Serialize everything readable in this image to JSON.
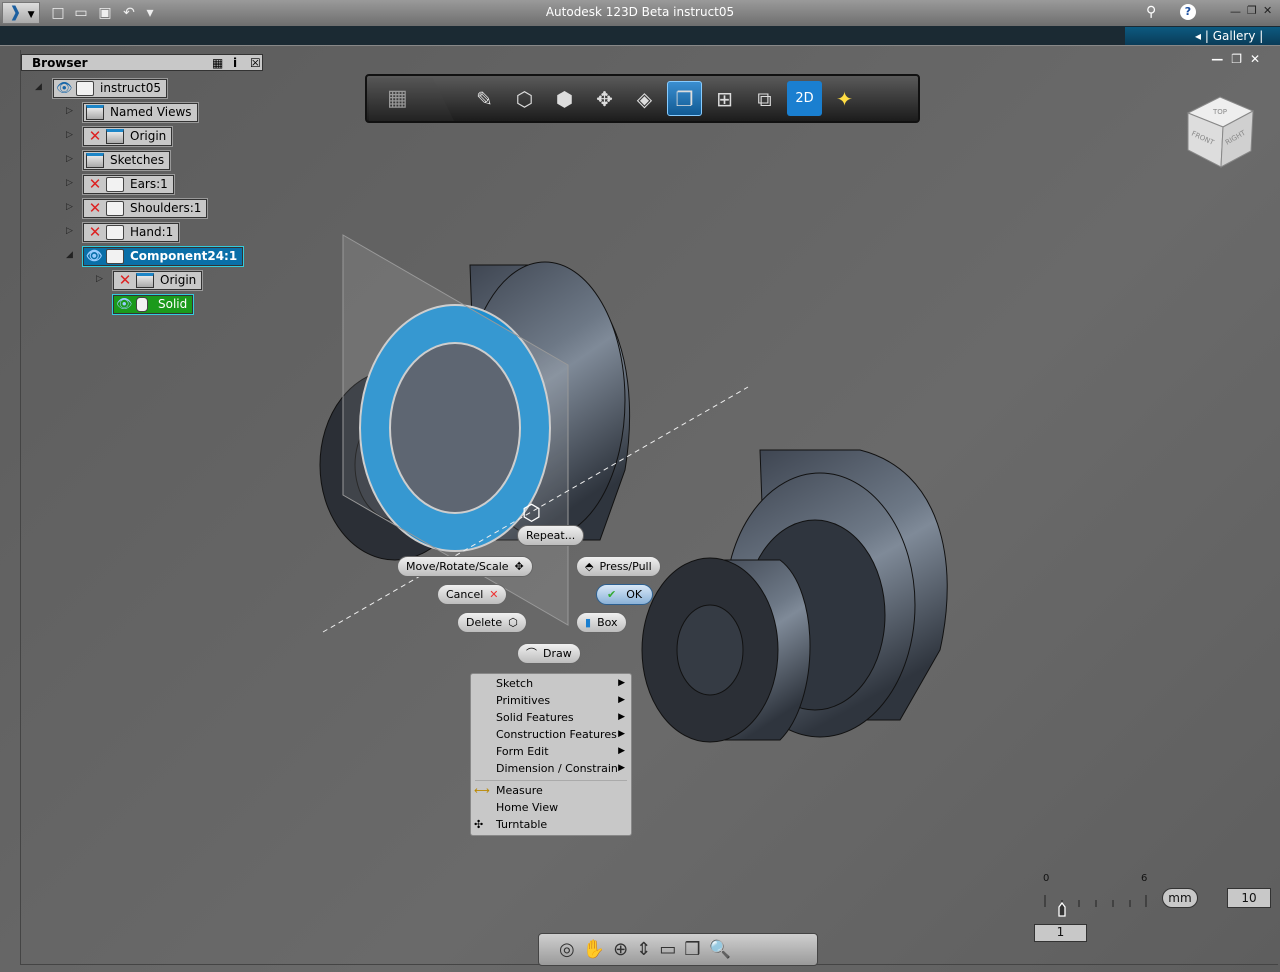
{
  "window": {
    "title": "Autodesk 123D Beta   instruct05",
    "gallery_label": "Gallery",
    "min": "—",
    "restore": "❐",
    "close": "✕"
  },
  "quick_access": [
    {
      "icon": "new-icon",
      "glyph": "□"
    },
    {
      "icon": "open-icon",
      "glyph": "▭"
    },
    {
      "icon": "save-icon",
      "glyph": "▣"
    },
    {
      "icon": "undo-icon",
      "glyph": "↶"
    },
    {
      "icon": "more-icon",
      "glyph": "▾"
    }
  ],
  "browser": {
    "title": "Browser",
    "nodes": [
      {
        "label": "instruct05",
        "visible": true
      },
      {
        "label": "Named Views"
      },
      {
        "label": "Origin",
        "visible": false
      },
      {
        "label": "Sketches"
      },
      {
        "label": "Ears:1",
        "visible": false
      },
      {
        "label": "Shoulders:1",
        "visible": false
      },
      {
        "label": "Hand:1",
        "visible": false
      },
      {
        "label": "Component24:1",
        "visible": true,
        "selected": true
      },
      {
        "label": "Origin",
        "visible": false
      },
      {
        "label": "Solid",
        "visible": true,
        "highlight": "#1b9a1b"
      }
    ]
  },
  "toolbar": {
    "tools": [
      "sketch-pencil",
      "primitive-box",
      "extrude",
      "move",
      "construct",
      "view-style",
      "multi-view",
      "pattern",
      "2d-drawing",
      "render"
    ],
    "active": "view-style"
  },
  "viewcube": {
    "top": "TOP",
    "front": "FRONT",
    "right": "RIGHT"
  },
  "marking_menu": {
    "repeat": "Repeat...",
    "move": "Move/Rotate/Scale",
    "press_pull": "Press/Pull",
    "cancel": "Cancel",
    "ok": "OK",
    "delete": "Delete",
    "box": "Box",
    "draw": "Draw"
  },
  "context_menu": {
    "items": [
      {
        "label": "Sketch",
        "submenu": true
      },
      {
        "label": "Primitives",
        "submenu": true
      },
      {
        "label": "Solid Features",
        "submenu": true
      },
      {
        "label": "Construction Features",
        "submenu": true
      },
      {
        "label": "Form Edit",
        "submenu": true
      },
      {
        "label": "Dimension / Constrain",
        "submenu": true
      }
    ],
    "items2": [
      {
        "label": "Measure",
        "icon": "ruler-icon"
      },
      {
        "label": "Home View"
      },
      {
        "label": "Turntable",
        "icon": "turntable-icon"
      }
    ]
  },
  "scale": {
    "min_label": "0",
    "max_label": "6",
    "unit": "mm",
    "grid_value": "10",
    "slider_value": "1",
    "slider_position": 1
  },
  "colors": {
    "selection": "#1f8fd0",
    "accent": "#0a6fa8"
  }
}
